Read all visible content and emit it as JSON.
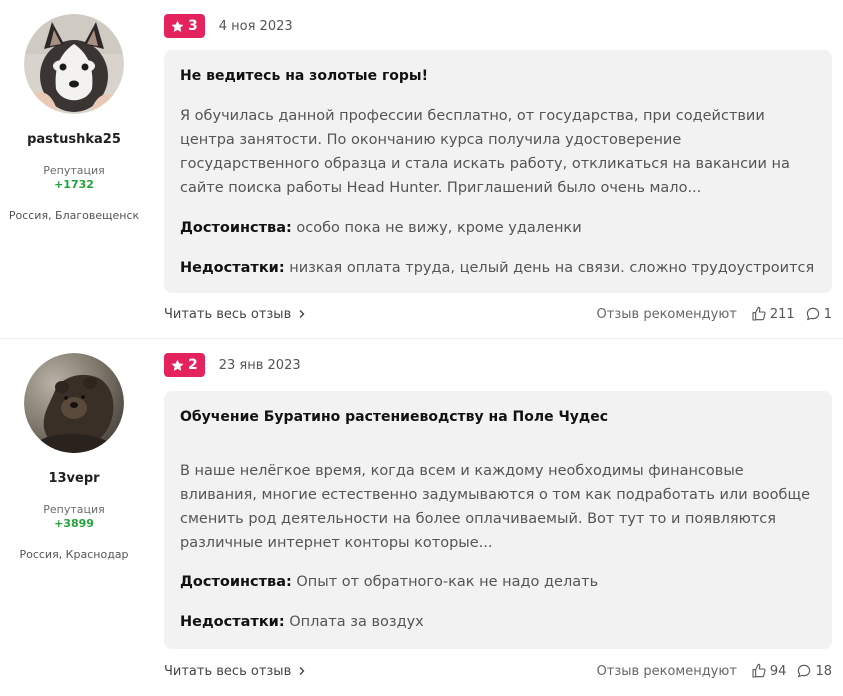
{
  "reviews": [
    {
      "author": {
        "username": "pastushka25",
        "reputation_label": "Репутация",
        "reputation": "+1732",
        "location": "Россия, Благовещенск",
        "avatar": "husky-puppy-avatar"
      },
      "rating": "3",
      "date": "4 ноя 2023",
      "title": "Не ведитесь на золотые горы!",
      "body": "Я обучилась данной профессии бесплатно, от государства, при содействии центра занятости. По окончанию курса получила удостоверение государственного образца и стала искать работу, откликаться на вакансии на сайте поиска работы Head Hunter. Приглашений было очень мало...",
      "pros_label": "Достоинства:",
      "pros": "особо пока не вижу, кроме удаленки",
      "cons_label": "Недостатки:",
      "cons": "низкая оплата труда, целый день на связи. сложно трудоустроится",
      "read_more": "Читать весь отзыв",
      "recommend_label": "Отзыв рекомендуют",
      "likes": "211",
      "comments": "1"
    },
    {
      "author": {
        "username": "13vepr",
        "reputation_label": "Репутация",
        "reputation": "+3899",
        "location": "Россия, Краснодар",
        "avatar": "bear-avatar"
      },
      "rating": "2",
      "date": "23 янв 2023",
      "title": "Обучение Буратино растениеводству на Поле Чудес",
      "body": "В наше нелёгкое время, когда всем и каждому необходимы финансовые вливания, многие естественно задумываются о том как подработать или вообще сменить род деятельности на более оплачиваемый. Вот тут то и появляются различные интернет конторы которые...",
      "pros_label": "Достоинства:",
      "pros": "Опыт от обратного-как не надо делать",
      "cons_label": "Недостатки:",
      "cons": "Оплата за воздух",
      "read_more": "Читать весь отзыв",
      "recommend_label": "Отзыв рекомендуют",
      "likes": "94",
      "comments": "18"
    }
  ],
  "colors": {
    "rating_badge": "#e4225e",
    "reputation": "#22a33c",
    "card_bg": "#f2f2f2"
  }
}
